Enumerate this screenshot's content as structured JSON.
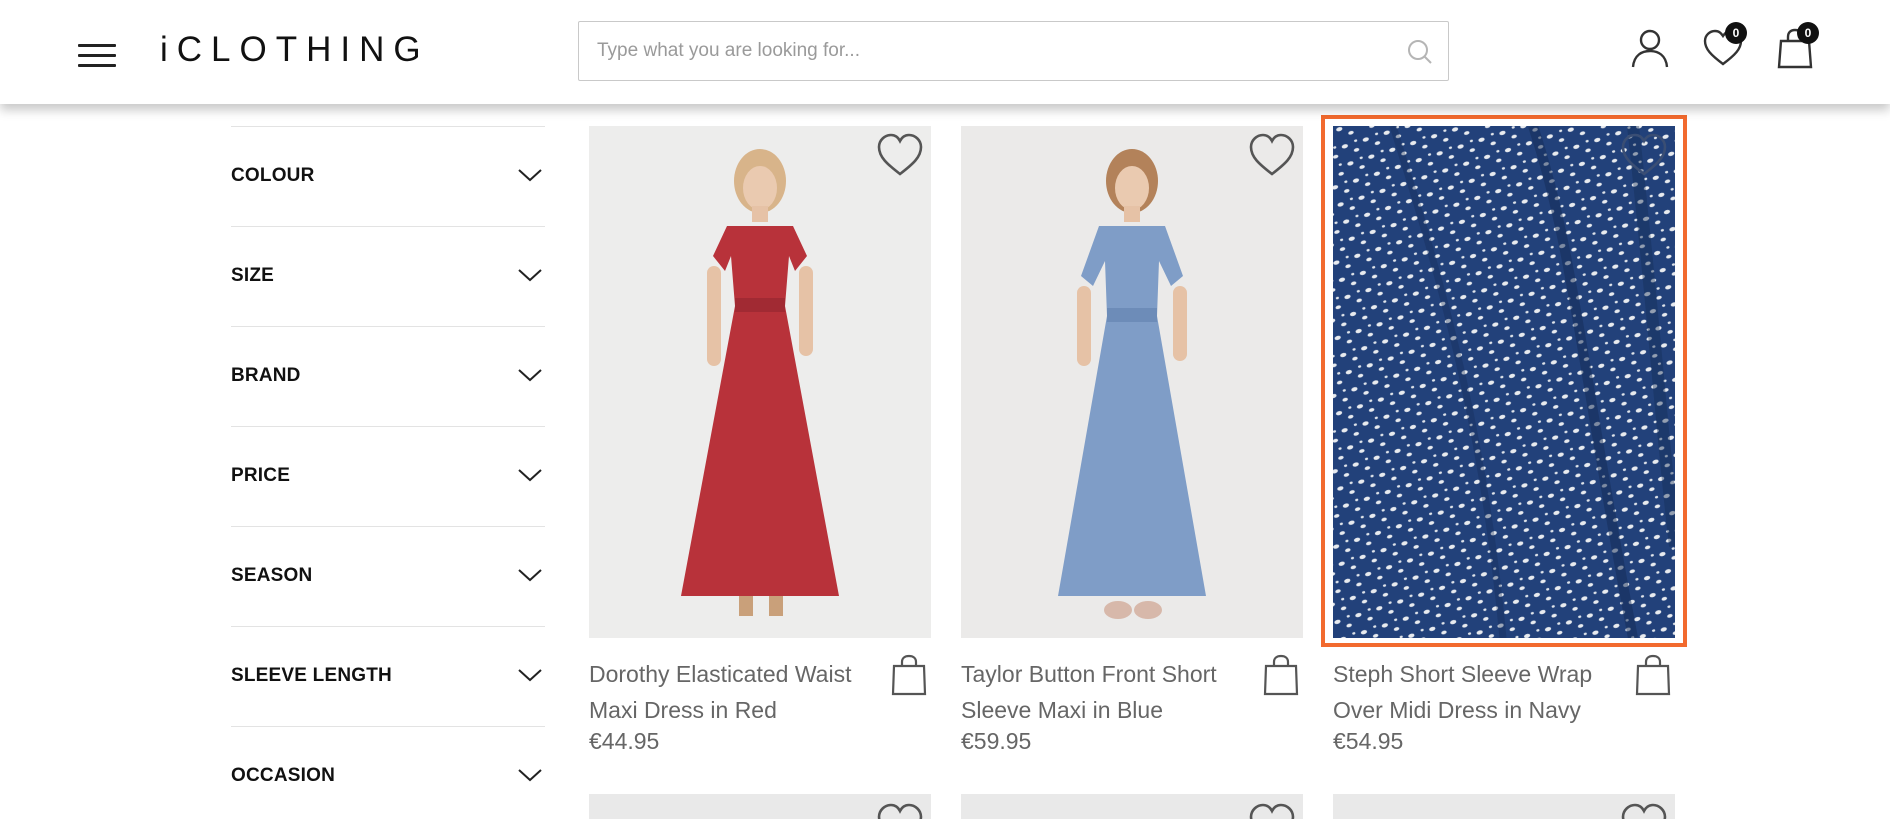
{
  "header": {
    "logo": "iCLOTHING",
    "search": {
      "placeholder": "Type what you are looking for..."
    },
    "wishlist_count": "0",
    "cart_count": "0"
  },
  "filters": [
    {
      "label": "COLOUR"
    },
    {
      "label": "SIZE"
    },
    {
      "label": "BRAND"
    },
    {
      "label": "PRICE"
    },
    {
      "label": "SEASON"
    },
    {
      "label": "SLEEVE LENGTH"
    },
    {
      "label": "OCCASION"
    }
  ],
  "products": [
    {
      "name": "Dorothy Elasticated Waist Maxi Dress in Red",
      "price": "€44.95"
    },
    {
      "name": "Taylor Button Front Short Sleeve Maxi in Blue",
      "price": "€59.95"
    },
    {
      "name": "Steph Short Sleeve Wrap Over Midi Dress in Navy",
      "price": "€54.95"
    }
  ],
  "colors": {
    "highlight": "#f26a2e",
    "red_dress": "#b8323a",
    "blue_dress": "#7f9dc7",
    "navy_fabric": "#22417a"
  }
}
